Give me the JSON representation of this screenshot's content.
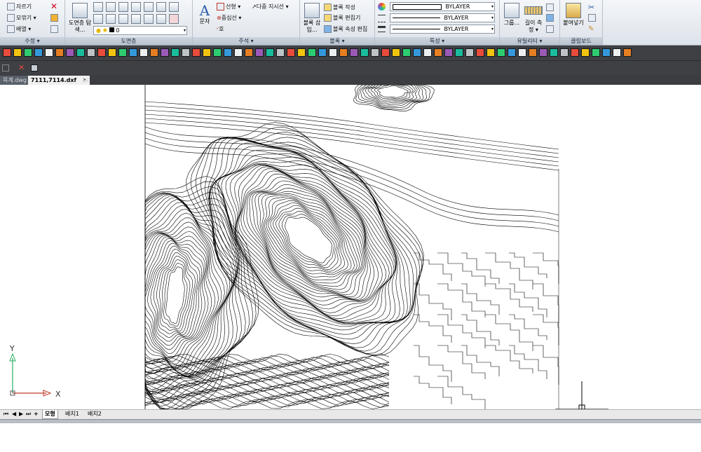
{
  "ribbon": {
    "modify": {
      "title": "수정 ▾",
      "buttons": [
        {
          "label": "자르기",
          "icon": "trim-icon"
        },
        {
          "label": "모깎기 ▾",
          "icon": "fillet-icon"
        },
        {
          "label": "배열 ▾",
          "icon": "array-icon"
        }
      ]
    },
    "layers": {
      "title": "도면층",
      "big_button": "도면층 탐색...",
      "current_layer": "0"
    },
    "annotation": {
      "title": "주석 ▾",
      "big_button": "문자",
      "buttons": [
        {
          "label": "선형 ▾",
          "icon": "linear-dim-icon"
        },
        {
          "label": "다중 지시선 ▾",
          "icon": "multileader-icon"
        },
        {
          "label": "중심선 ▾",
          "icon": "centerline-icon"
        },
        {
          "label": "호",
          "icon": "arc-dim-icon"
        }
      ]
    },
    "block": {
      "title": "블록 ▾",
      "big_button": "블록 삽입...",
      "buttons": [
        {
          "label": "블록 작성",
          "icon": "create-block-icon"
        },
        {
          "label": "블록 편집기",
          "icon": "block-editor-icon"
        },
        {
          "label": "블록 속성 편집",
          "icon": "edit-attribute-icon"
        }
      ]
    },
    "properties": {
      "title": "특성 ▾",
      "color": "BYLAYER",
      "linetype": "BYLAYER",
      "lineweight": "BYLAYER"
    },
    "utilities": {
      "title": "유틸리티 ▾",
      "group_label": "그룹...",
      "measure_label": "길이 측정 ▾"
    },
    "clipboard": {
      "title": "클립보드",
      "paste_label": "붙여넣기"
    }
  },
  "doc_tabs": [
    {
      "label": "목계.dwg",
      "active": false
    },
    {
      "label": "7111,7114.dxf",
      "active": true
    }
  ],
  "layout_tabs": {
    "model": "모형",
    "layout1": "배치1",
    "layout2": "배치2"
  },
  "ucs": {
    "x_label": "X",
    "y_label": "Y"
  },
  "colors": {
    "ribbon_bg": "#e4e9ef",
    "toolbar_bg": "#3e4044",
    "ucs_x": "#c0392b",
    "ucs_y": "#27ae60"
  }
}
